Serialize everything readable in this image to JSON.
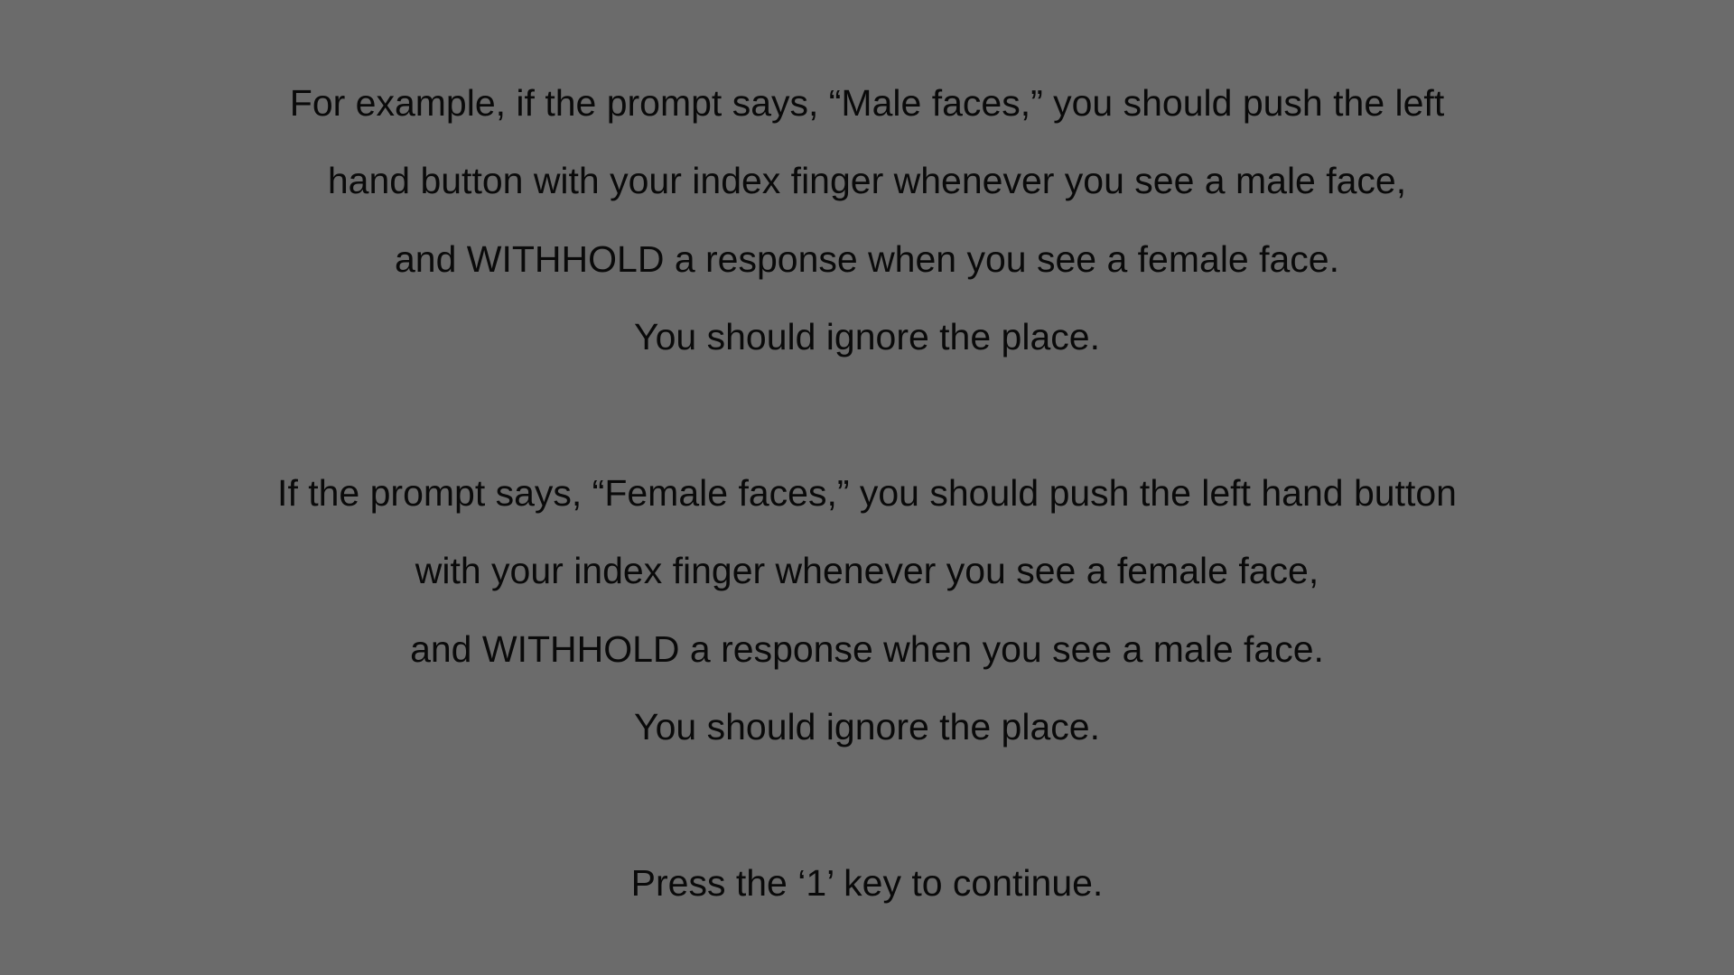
{
  "instructions": {
    "block1": [
      "For example, if the prompt says, “Male faces,” you should push the left",
      "hand button with your index finger whenever you see a male face,",
      "and WITHHOLD a response when you see a female face.",
      "You should ignore the place."
    ],
    "block2": [
      "If the prompt says, “Female faces,” you should push the left hand button",
      "with your index finger whenever you see a female face,",
      "and WITHHOLD a response when you see a male face.",
      "You should ignore the place."
    ],
    "continue_prompt": "Press the ‘1’ key to continue."
  },
  "colors": {
    "background": "#6b6b6b",
    "text": "#0a0a0a"
  }
}
